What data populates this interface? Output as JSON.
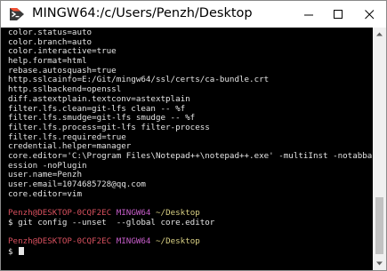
{
  "window": {
    "title": "MINGW64:/c/Users/Penzh/Desktop",
    "icon": "git-bash-icon"
  },
  "colors": {
    "terminal_bg": "#000000",
    "text": "#e4e4e4",
    "prompt_user": "#d7505e",
    "prompt_system": "#c85ecb",
    "prompt_dir": "#d8cf83"
  },
  "terminal": {
    "config_lines": [
      "color.status=auto",
      "color.branch=auto",
      "color.interactive=true",
      "help.format=html",
      "rebase.autosquash=true",
      "http.sslcainfo=E:/Git/mingw64/ssl/certs/ca-bundle.crt",
      "http.sslbackend=openssl",
      "diff.astextplain.textconv=astextplain",
      "filter.lfs.clean=git-lfs clean -- %f",
      "filter.lfs.smudge=git-lfs smudge -- %f",
      "filter.lfs.process=git-lfs filter-process",
      "filter.lfs.required=true",
      "credential.helper=manager",
      "core.editor='C:\\Program Files\\Notepad++\\notepad++.exe' -multiInst -notabbar -nos",
      "ession -noPlugin",
      "user.name=Penzh",
      "user.email=1074685728@qq.com",
      "core.editor=vim"
    ],
    "prompt1": {
      "user": "Penzh@DESKTOP-0CQF2EC",
      "system": "MINGW64",
      "dir": "~/Desktop"
    },
    "command1": "$ git config --unset  --global core.editor",
    "prompt2": {
      "user": "Penzh@DESKTOP-0CQF2EC",
      "system": "MINGW64",
      "dir": "~/Desktop"
    },
    "command2": "$ "
  }
}
